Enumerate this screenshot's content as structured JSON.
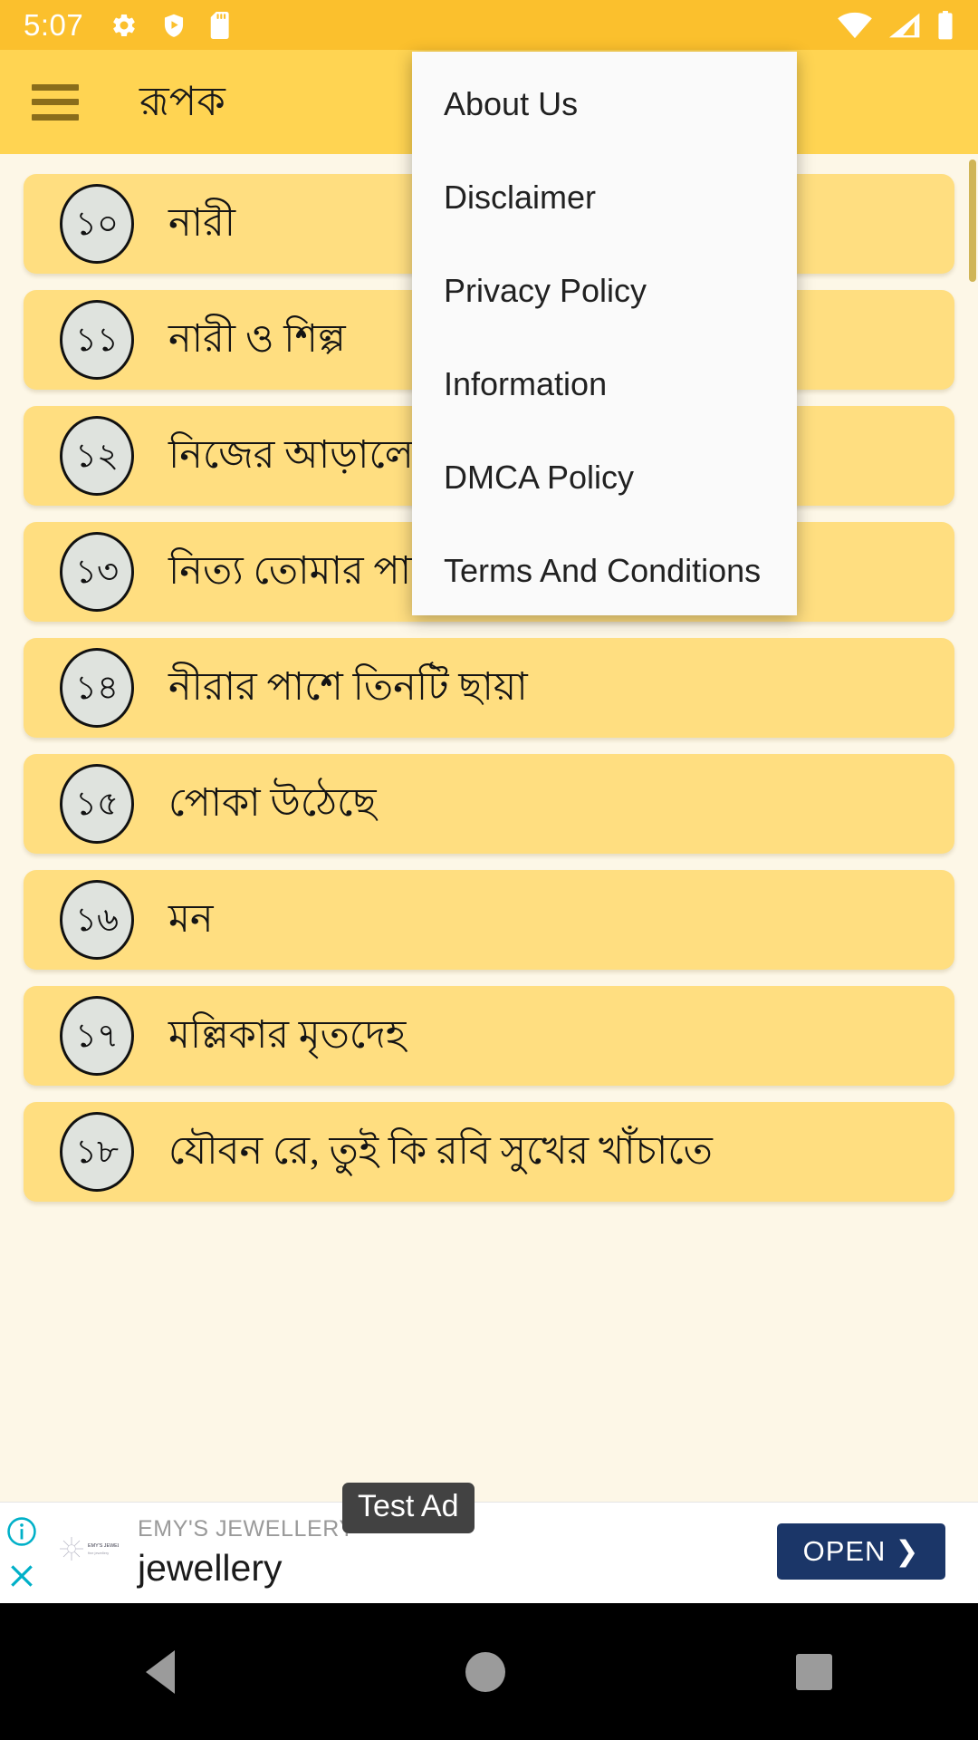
{
  "status_bar": {
    "time": "5:07",
    "left_icons": [
      "gear-icon",
      "play-protect-shield-icon",
      "sd-card-icon"
    ],
    "right_icons": [
      "wifi-icon",
      "cellular-signal-icon",
      "battery-icon"
    ],
    "background": "#fbc02d"
  },
  "app_bar": {
    "menu_icon": "hamburger-menu-icon",
    "title": "রূপক",
    "background": "#ffd452"
  },
  "overflow_menu": {
    "visible": true,
    "items": [
      {
        "label": "About Us"
      },
      {
        "label": "Disclaimer"
      },
      {
        "label": "Privacy Policy"
      },
      {
        "label": "Information"
      },
      {
        "label": "DMCA Policy"
      },
      {
        "label": "Terms And Conditions"
      }
    ]
  },
  "list": {
    "items": [
      {
        "number": "১০",
        "title": "নারী"
      },
      {
        "number": "১১",
        "title": "নারী ও শিল্প"
      },
      {
        "number": "১২",
        "title": "নিজের আড়ালে"
      },
      {
        "number": "১৩",
        "title": "নিত্য তোমার পায়ের ব"
      },
      {
        "number": "১৪",
        "title": "নীরার পাশে তিনটি ছায়া"
      },
      {
        "number": "১৫",
        "title": "পোকা উঠেছে"
      },
      {
        "number": "১৬",
        "title": "মন"
      },
      {
        "number": "১৭",
        "title": "মল্লিকার মৃতদেহ"
      },
      {
        "number": "১৮",
        "title": "যৌবন রে, তুই কি রবি সুখের খাঁচাতে"
      }
    ],
    "item_background": "#ffde80",
    "page_background": "#fdf7e7"
  },
  "ad": {
    "test_tag": "Test Ad",
    "advertiser": "EMY'S JEWELLERY",
    "headline": "jewellery",
    "cta_label": "OPEN",
    "cta_chevron": "❯",
    "cta_color": "#1b3668",
    "info_icon": "info-circle-icon",
    "close_icon": "close-x-icon",
    "logo_icon": "advertiser-logo-icon"
  },
  "nav_bar": {
    "back": "back-triangle-icon",
    "home": "home-circle-icon",
    "recents": "recents-square-icon"
  }
}
